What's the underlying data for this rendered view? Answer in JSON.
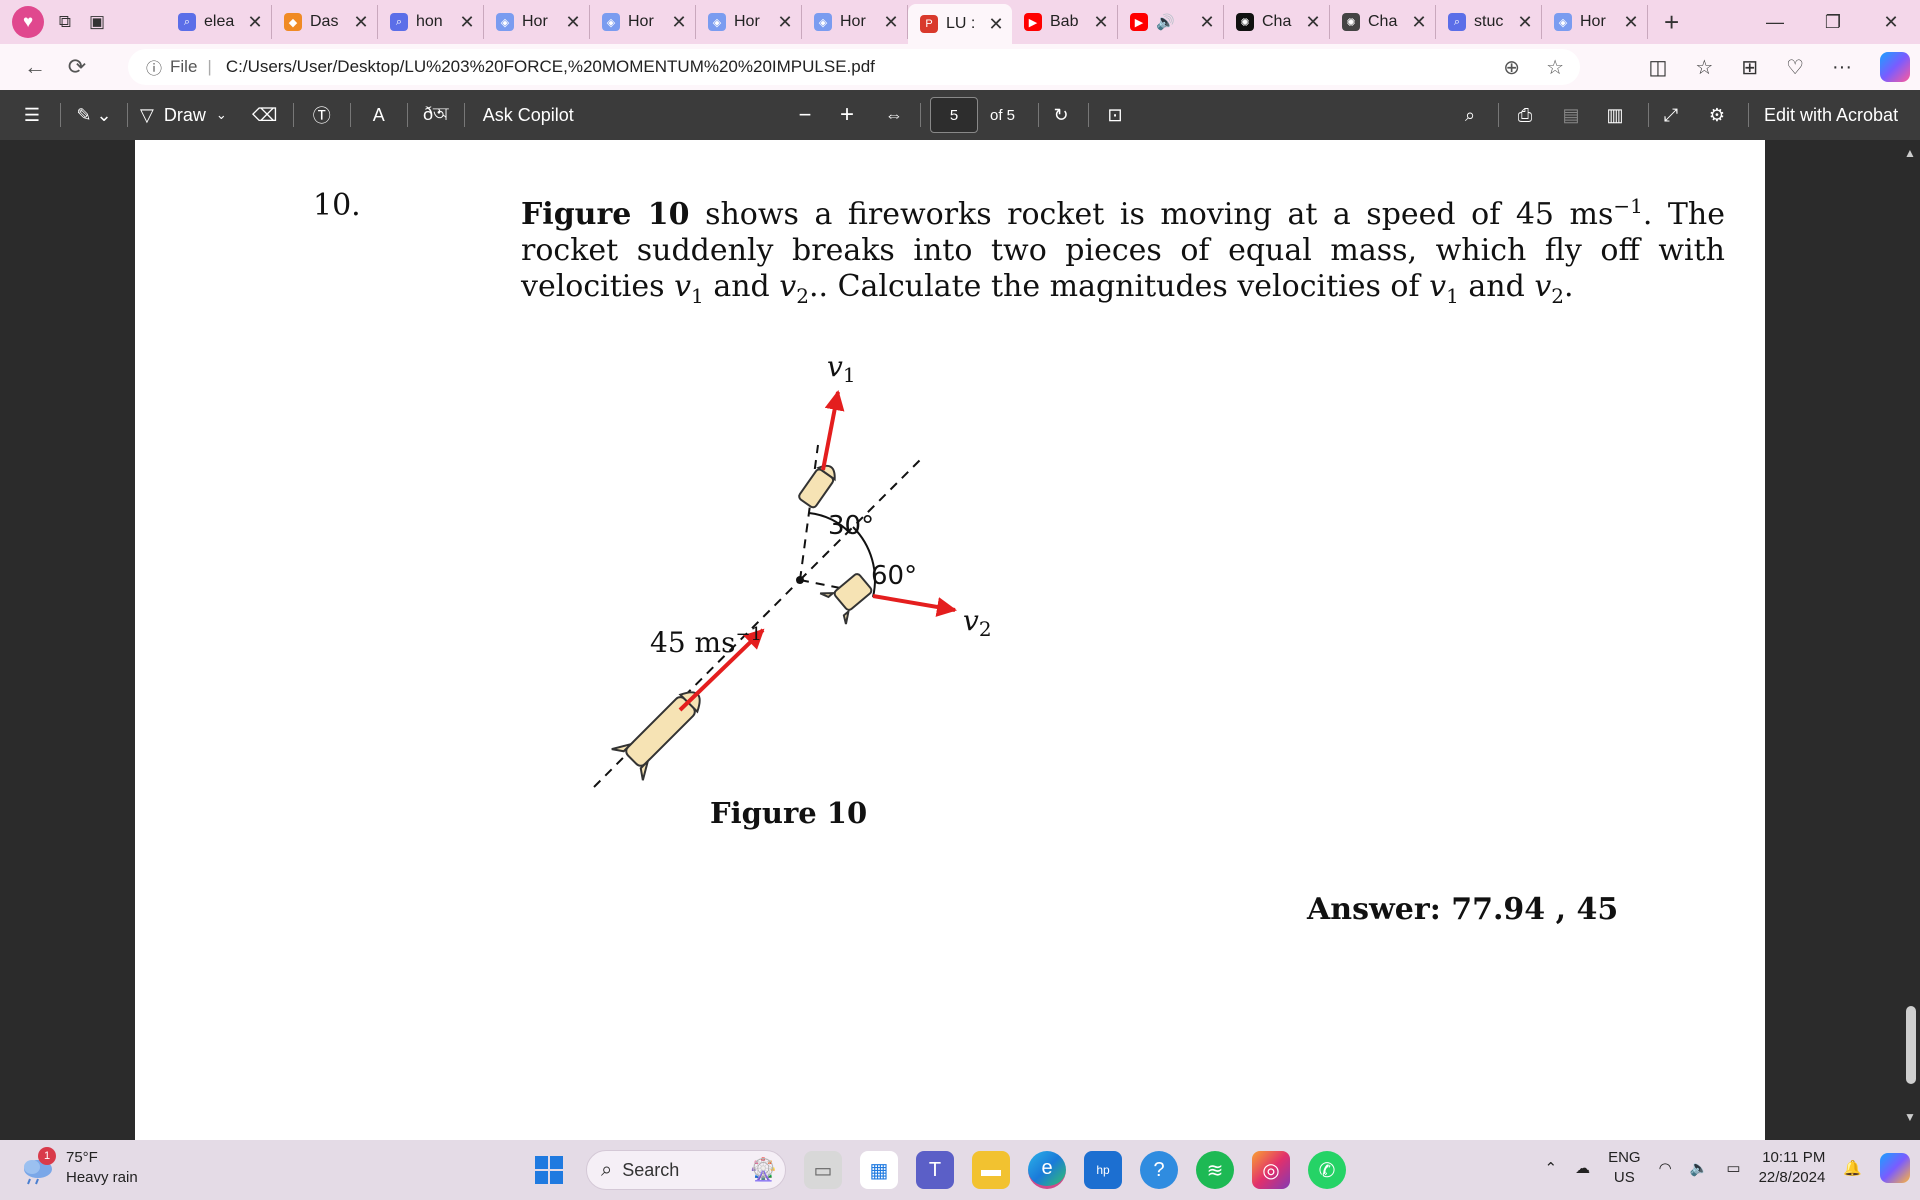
{
  "browser": {
    "tabs": [
      {
        "label": "elea",
        "icon": "search-icon",
        "color": "#5b6ee8"
      },
      {
        "label": "Das",
        "icon": "dashboard-icon",
        "color": "#f08a24"
      },
      {
        "label": "hon",
        "icon": "search-icon",
        "color": "#5b6ee8"
      },
      {
        "label": "Hor",
        "icon": "cube-icon",
        "color": "#7a9cf0"
      },
      {
        "label": "Hor",
        "icon": "cube-icon",
        "color": "#7a9cf0"
      },
      {
        "label": "Hor",
        "icon": "cube-icon",
        "color": "#7a9cf0"
      },
      {
        "label": "Hor",
        "icon": "cube-icon",
        "color": "#7a9cf0"
      },
      {
        "label": "LU :",
        "icon": "pdf-icon",
        "color": "#d9392c",
        "active": true
      },
      {
        "label": "Bab",
        "icon": "youtube-icon",
        "color": "#ff0000"
      },
      {
        "label": "",
        "icon": "youtube-icon",
        "color": "#ff0000",
        "audio": true
      },
      {
        "label": "Cha",
        "icon": "chatgpt-icon",
        "color": "#111111"
      },
      {
        "label": "Cha",
        "icon": "chatgpt-icon",
        "color": "#444444"
      },
      {
        "label": "stuc",
        "icon": "search-icon",
        "color": "#5b6ee8"
      },
      {
        "label": "Hor",
        "icon": "cube-icon",
        "color": "#7a9cf0"
      }
    ],
    "address": {
      "file_label": "File",
      "url": "C:/Users/User/Desktop/LU%203%20FORCE,%20MOMENTUM%20%20IMPULSE.pdf"
    }
  },
  "pdf_toolbar": {
    "draw_label": "Draw",
    "copilot_label": "Ask Copilot",
    "page_current": "5",
    "page_total": "of 5",
    "acrobat_label": "Edit with Acrobat",
    "read_aloud": "A",
    "translate": "ðঅ"
  },
  "document": {
    "question_number": "10.",
    "question_lead_bold": "Figure 10",
    "question_part1": " shows a fireworks rocket is moving at a speed of 45 ms",
    "question_exp": "−1",
    "question_part2": ". The rocket suddenly breaks into two pieces of equal mass, which fly off with velocities ",
    "v1_label": "v",
    "sub1": "1",
    "and": " and ",
    "sub2": "2",
    "question_part3": ". Calculate the magnitudes velocities of ",
    "figure": {
      "speed_label": "45 ms",
      "speed_exp": "−1",
      "angle1": "30°",
      "angle2": "60°",
      "v1": "v",
      "v1_sub": "1",
      "v2": "v",
      "v2_sub": "2",
      "caption": "Figure 10"
    },
    "answer": "Answer: 77.94 , 45"
  },
  "taskbar": {
    "weather_temp": "75°F",
    "weather_desc": "Heavy rain",
    "weather_badge": "1",
    "search_label": "Search",
    "lang1": "ENG",
    "lang2": "US",
    "time": "10:11 PM",
    "date": "22/8/2024"
  }
}
